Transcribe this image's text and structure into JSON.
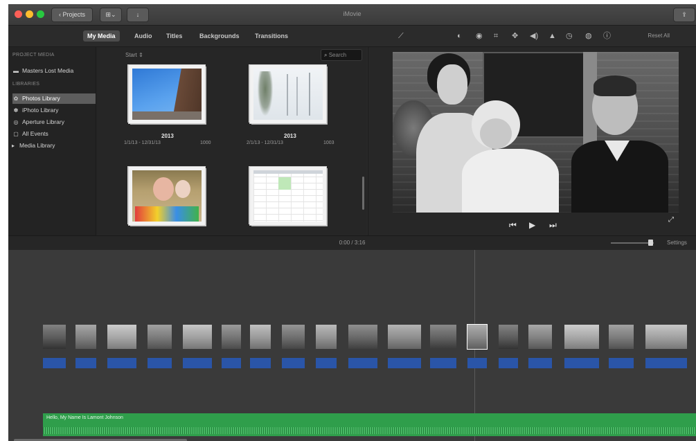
{
  "window": {
    "title": "iMovie"
  },
  "titlebar": {
    "back_label": "Projects",
    "import_icon": "import-icon",
    "download_icon": "download-icon"
  },
  "tabs": [
    {
      "label": "My Media",
      "active": true
    },
    {
      "label": "Audio",
      "active": false
    },
    {
      "label": "Titles",
      "active": false
    },
    {
      "label": "Backgrounds",
      "active": false
    },
    {
      "label": "Transitions",
      "active": false
    }
  ],
  "viewer_tools": {
    "reset_label": "Reset All",
    "icons": [
      "magic-wand-icon",
      "color-balance-icon",
      "color-correction-icon",
      "crop-icon",
      "stabilization-icon",
      "volume-icon",
      "noise-reduction-icon",
      "speed-icon",
      "filter-icon",
      "info-icon"
    ]
  },
  "sidebar": {
    "project_heading": "PROJECT MEDIA",
    "project_item": "Masters Lost Media",
    "libraries_heading": "LIBRARIES",
    "items": [
      {
        "label": "Photos Library",
        "icon": "photos-icon",
        "selected": true
      },
      {
        "label": "iPhoto Library",
        "icon": "iphoto-icon",
        "selected": false
      },
      {
        "label": "Aperture Library",
        "icon": "aperture-icon",
        "selected": false
      },
      {
        "label": "All Events",
        "icon": "events-icon",
        "selected": false
      },
      {
        "label": "Media Library",
        "icon": "disclosure-icon",
        "selected": false
      }
    ]
  },
  "browser": {
    "filter_label": "Start ⇕",
    "search_placeholder": "Search",
    "items": [
      {
        "year": "2013",
        "range": "1/1/13 - 12/31/13",
        "count": "1000"
      },
      {
        "year": "2013",
        "range": "2/1/13 - 12/31/13",
        "count": "1003"
      },
      {
        "year": "",
        "range": "",
        "count": ""
      },
      {
        "year": "",
        "range": "",
        "count": ""
      }
    ]
  },
  "playback": {
    "timecode": "0:00 / 3:16",
    "zoom_label": "Settings"
  },
  "timeline": {
    "clip_count": 18,
    "audio_label": "Hello, My Name Is Lamont Johnson"
  },
  "colors": {
    "clip_bar": "#2a55a8",
    "audio_track": "#2f9e4b",
    "selected_sidebar": "#5d5d5d"
  }
}
